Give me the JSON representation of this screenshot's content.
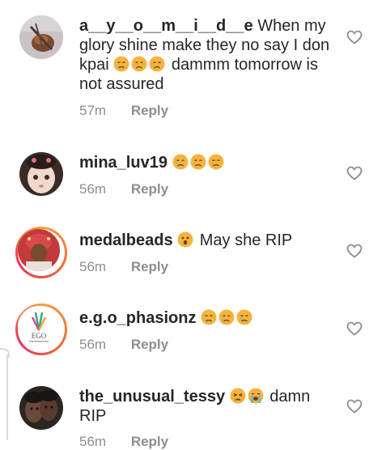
{
  "comments": [
    {
      "username": "a__y__o__m__i__d__e",
      "text": "When my glory shine make they no say I don kpai",
      "text_after": "dammm tomorrow is not assured",
      "emoji": [
        "crying-face",
        "crying-face",
        "crying-face"
      ],
      "time": "57m",
      "reply": "Reply"
    },
    {
      "username": "mina_luv19",
      "text": "",
      "emoji": [
        "crying-face",
        "crying-face",
        "crying-face"
      ],
      "time": "56m",
      "reply": "Reply"
    },
    {
      "username": "medalbeads",
      "text": "May she RIP",
      "emoji": [
        "astonished-face"
      ],
      "time": "56m",
      "reply": "Reply"
    },
    {
      "username": "e.g.o_phasionz",
      "text": "",
      "emoji": [
        "crying-face",
        "crying-face",
        "crying-face"
      ],
      "time": "56m",
      "reply": "Reply",
      "avatar_logo": "EGO"
    },
    {
      "username": "the_unusual_tessy",
      "text": "damn RIP",
      "emoji": [
        "weary-face",
        "loudly-crying-face"
      ],
      "time": "56m",
      "reply": "Reply"
    }
  ],
  "icons": {
    "like": "heart-outline-icon"
  },
  "colors": {
    "text": "#262626",
    "meta": "#8e8e8e",
    "story_ring": [
      "#f7a03a",
      "#e8345f"
    ]
  }
}
